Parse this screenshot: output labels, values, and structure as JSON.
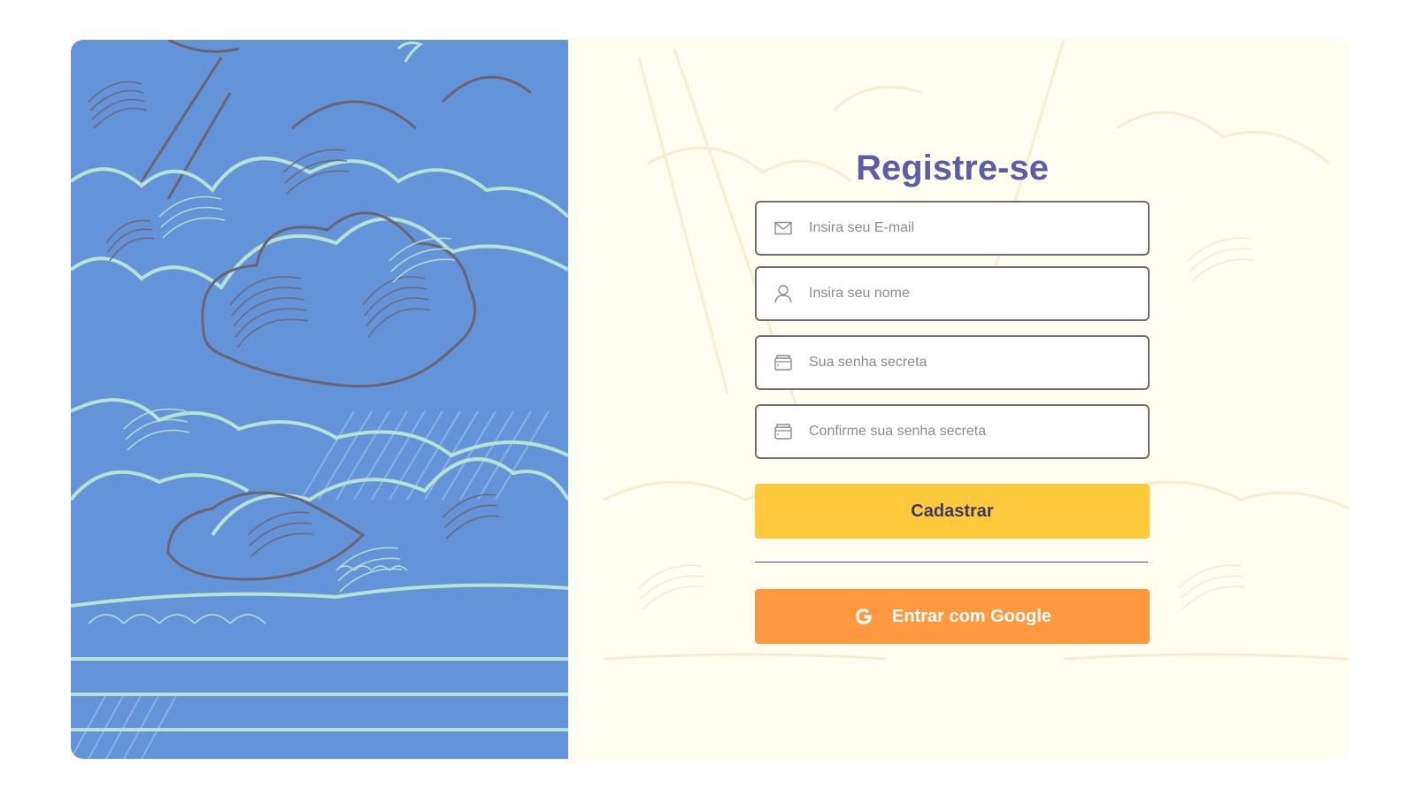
{
  "form": {
    "title": "Registre-se",
    "email": {
      "placeholder": "Insira seu E-mail",
      "icon": "mail-icon"
    },
    "name": {
      "placeholder": "Insira seu nome",
      "icon": "user-icon"
    },
    "password": {
      "placeholder": "Sua senha secreta",
      "icon": "wallet-icon"
    },
    "confirm_password": {
      "placeholder": "Confirme sua senha secreta",
      "icon": "wallet-icon"
    },
    "submit_label": "Cadastrar",
    "google_label": "Entrar com Google",
    "google_icon": "google-icon"
  },
  "colors": {
    "illustration_background": "#6393d8",
    "panel_background": "#fffdef",
    "title": "#5b5ea6",
    "submit_button": "#ffc93c",
    "google_button": "#ff9940",
    "divider": "#4f4f8a"
  }
}
